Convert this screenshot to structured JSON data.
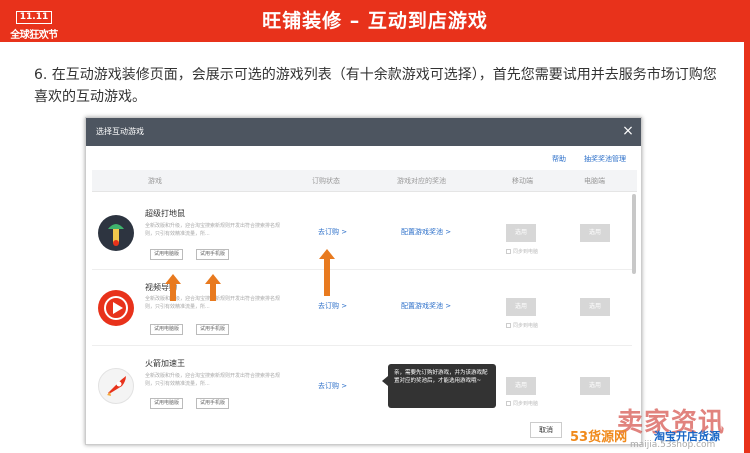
{
  "header": {
    "logo_top": "11.11",
    "logo_bottom": "全球狂欢节",
    "title": "旺铺装修 – 互动到店游戏"
  },
  "step_text": "6. 在互动游戏装修页面，会展示可选的游戏列表（有十余款游戏可选择），首先您需要试用并去服务市场订购您喜欢的互动游戏。",
  "dialog": {
    "title": "选择互动游戏",
    "close_icon": "×",
    "help_link": "帮助",
    "manage_link": "抽奖奖池管理",
    "columns": [
      "游戏",
      "订购状态",
      "游戏对应的奖池",
      "移动端",
      "电脑端"
    ],
    "rows": [
      {
        "name": "超级打地鼠",
        "desc": "全新改版和升级，迎合淘宝搜索新规则开发出符合搜索排名规则，只引有效精准流量，所...",
        "try_pc": "试用电脑版",
        "try_mobile": "试用手机版",
        "subscribe": "去订购 >",
        "prize": "配置游戏奖池 >",
        "mobile_btn": "选用",
        "pc_btn": "选用",
        "sync": "同步到电脑",
        "icon": "whack-a-mole-icon"
      },
      {
        "name": "视频导购",
        "desc": "全新改版和升级，迎合淘宝搜索新规则开发出符合搜索排名规则，只引有效精准流量，所...",
        "try_pc": "试用电脑版",
        "try_mobile": "试用手机版",
        "subscribe": "去订购 >",
        "prize": "配置游戏奖池 >",
        "mobile_btn": "选用",
        "pc_btn": "选用",
        "sync": "同步到电脑",
        "icon": "video-play-icon"
      },
      {
        "name": "火箭加速王",
        "desc": "全新改版和升级，迎合淘宝搜索新规则开发出符合搜索排名规则，只引有效精准流量，所...",
        "try_pc": "试用电脑版",
        "try_mobile": "试用手机版",
        "subscribe": "去订购 >",
        "mobile_btn": "选用",
        "pc_btn": "选用",
        "sync": "同步到电脑",
        "icon": "rocket-icon"
      }
    ],
    "tooltip": "亲，需要先订购好游戏，并为该游戏配置对应的奖池后，才能选用游戏哦~",
    "cancel": "取消"
  },
  "watermark": {
    "big": "卖家资讯",
    "brand": "53货源网",
    "taobao": "淘宝开店货源",
    "url": "maijia.53shop.com"
  },
  "colors": {
    "header": "#e8321b",
    "link": "#2a6ec9",
    "arrow": "#e87a1f",
    "tooltip": "#333333"
  }
}
